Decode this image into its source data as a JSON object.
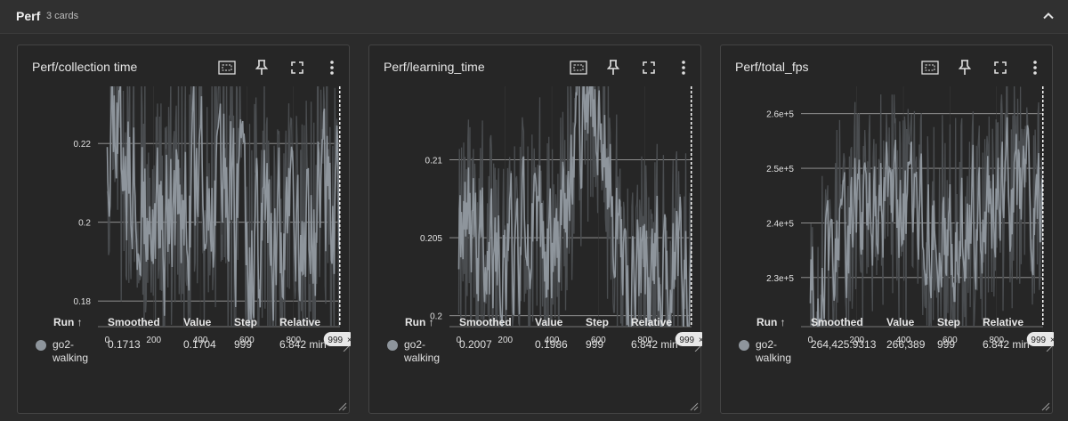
{
  "section": {
    "title": "Perf",
    "count": "3 cards"
  },
  "colors": {
    "line": "#8e959c",
    "line_raw": "#4a4d50",
    "grid": "#9e9e9e",
    "background": "#262626"
  },
  "cards": [
    {
      "title": "Perf/collection time",
      "step_badge": "999",
      "stats": {
        "headers": {
          "run": "Run ↑",
          "smoothed": "Smoothed",
          "value": "Value",
          "step": "Step",
          "relative": "Relative"
        },
        "run": "go2-\nwalking",
        "smoothed": "0.1713",
        "value": "0.1704",
        "step": "999",
        "relative": "6.842 min"
      }
    },
    {
      "title": "Perf/learning_time",
      "step_badge": "999",
      "stats": {
        "headers": {
          "run": "Run ↑",
          "smoothed": "Smoothed",
          "value": "Value",
          "step": "Step",
          "relative": "Relative"
        },
        "run": "go2-\nwalking",
        "smoothed": "0.2007",
        "value": "0.1986",
        "step": "999",
        "relative": "6.842 min"
      }
    },
    {
      "title": "Perf/total_fps",
      "step_badge": "999",
      "stats": {
        "headers": {
          "run": "Run ↑",
          "smoothed": "Smoothed",
          "value": "Value",
          "step": "Step",
          "relative": "Relative"
        },
        "run": "go2-\nwalking",
        "smoothed": "264,425.9313",
        "value": "266,389",
        "step": "999",
        "relative": "6.842 min"
      }
    }
  ],
  "chart_data": [
    {
      "type": "line",
      "series": [
        {
          "name": "go2-walking",
          "values_description": "noisy oscillating series"
        }
      ],
      "x_ticks": [
        "0",
        "200",
        "400",
        "600",
        "800"
      ],
      "y_ticks": [
        "0.18",
        "0.2",
        "0.22"
      ],
      "xlim": [
        -40,
        1000
      ],
      "ylim": [
        0.1735,
        0.2345
      ],
      "grid": true,
      "x_range": [
        0,
        999
      ],
      "last_value": 0.1704,
      "smoothed_last": 0.1713,
      "band": [
        0.1735,
        0.2345
      ],
      "seed": 11,
      "trend": [
        [
          0,
          0.226
        ],
        [
          80,
          0.218
        ],
        [
          200,
          0.198
        ],
        [
          300,
          0.202
        ],
        [
          450,
          0.212
        ],
        [
          600,
          0.196
        ],
        [
          800,
          0.198
        ],
        [
          999,
          0.205
        ]
      ],
      "swing": 0.028
    },
    {
      "type": "line",
      "series": [
        {
          "name": "go2-walking",
          "values_description": "noisy oscillating series"
        }
      ],
      "x_ticks": [
        "0",
        "200",
        "400",
        "600",
        "800"
      ],
      "y_ticks": [
        "0.2",
        "0.205",
        "0.21"
      ],
      "xlim": [
        -40,
        1000
      ],
      "ylim": [
        0.1993,
        0.2147
      ],
      "grid": true,
      "x_range": [
        0,
        999
      ],
      "last_value": 0.1986,
      "smoothed_last": 0.2007,
      "band": [
        0.1993,
        0.2147
      ],
      "seed": 29,
      "trend": [
        [
          0,
          0.206
        ],
        [
          150,
          0.203
        ],
        [
          300,
          0.206
        ],
        [
          420,
          0.203
        ],
        [
          520,
          0.212
        ],
        [
          600,
          0.213
        ],
        [
          700,
          0.202
        ],
        [
          850,
          0.203
        ],
        [
          999,
          0.203
        ]
      ],
      "swing": 0.006
    },
    {
      "type": "line",
      "series": [
        {
          "name": "go2-walking",
          "values_description": "noisy oscillating series"
        }
      ],
      "x_ticks": [
        "0",
        "200",
        "400",
        "600",
        "800"
      ],
      "y_ticks": [
        "2.3e+5",
        "2.4e+5",
        "2.5e+5",
        "2.6e+5"
      ],
      "xlim": [
        -40,
        1000
      ],
      "ylim": [
        221000,
        265000
      ],
      "grid": true,
      "x_range": [
        0,
        999
      ],
      "last_value": 266389,
      "smoothed_last": 264425.9313,
      "band": [
        221000,
        265000
      ],
      "seed": 53,
      "trend": [
        [
          0,
          228000
        ],
        [
          80,
          232000
        ],
        [
          150,
          238000
        ],
        [
          300,
          244000
        ],
        [
          450,
          242000
        ],
        [
          520,
          240000
        ],
        [
          600,
          236000
        ],
        [
          700,
          242000
        ],
        [
          850,
          246000
        ],
        [
          999,
          244000
        ]
      ],
      "swing": 16000
    }
  ]
}
